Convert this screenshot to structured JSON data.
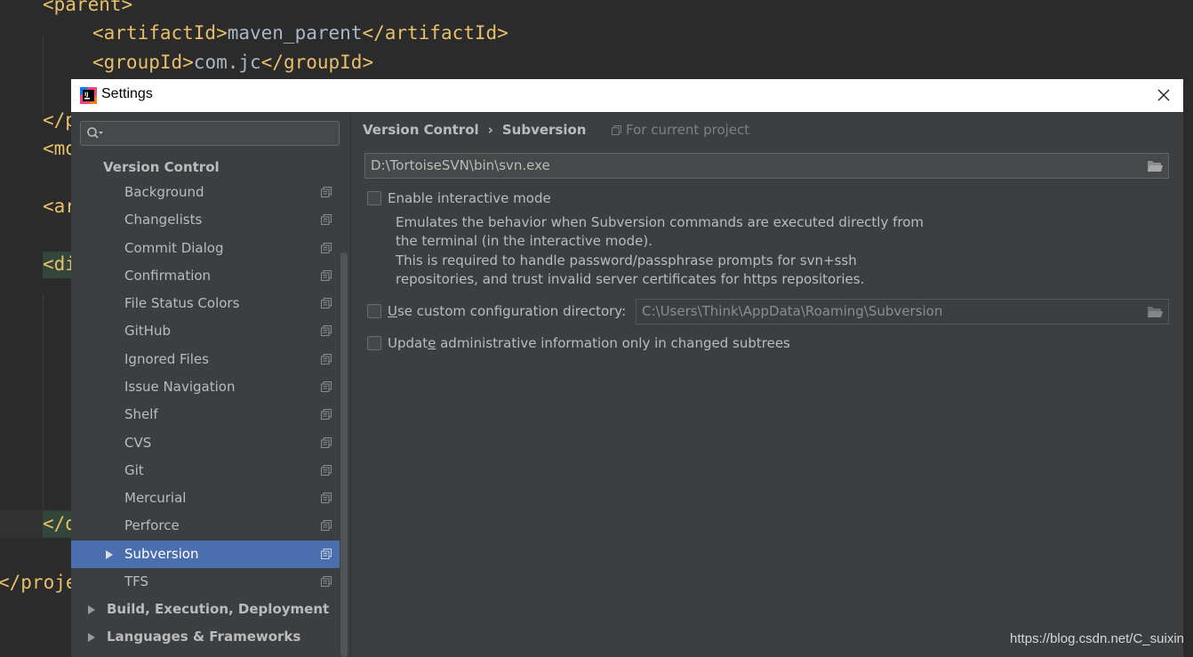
{
  "editor": {
    "lines": [
      {
        "open": "<parent>",
        "text": "",
        "close": ""
      },
      {
        "open": "<artifactId>",
        "text": "maven_parent",
        "close": "</artifactId>"
      },
      {
        "open": "<groupId>",
        "text": "com.jc",
        "close": "</groupId>"
      },
      {
        "open": "</p",
        "text": "",
        "close": ""
      },
      {
        "open": "<mo",
        "text": "",
        "close": ""
      },
      {
        "open": "<ar",
        "text": "",
        "close": ""
      },
      {
        "open": "<di",
        "text": "",
        "close": ""
      },
      {
        "open": "</d",
        "text": "",
        "close": ""
      },
      {
        "open": "</proje",
        "text": "",
        "close": ""
      }
    ]
  },
  "dialog": {
    "title": "Settings",
    "close_icon": "close-icon",
    "search": {
      "placeholder": ""
    },
    "tree": {
      "group_label": "Version Control",
      "items": [
        {
          "label": "Background"
        },
        {
          "label": "Changelists"
        },
        {
          "label": "Commit Dialog"
        },
        {
          "label": "Confirmation"
        },
        {
          "label": "File Status Colors"
        },
        {
          "label": "GitHub"
        },
        {
          "label": "Ignored Files"
        },
        {
          "label": "Issue Navigation"
        },
        {
          "label": "Shelf"
        },
        {
          "label": "CVS"
        },
        {
          "label": "Git"
        },
        {
          "label": "Mercurial"
        },
        {
          "label": "Perforce"
        },
        {
          "label": "Subversion",
          "selected": true
        },
        {
          "label": "TFS"
        }
      ],
      "sections": [
        {
          "label": "Build, Execution, Deployment"
        },
        {
          "label": "Languages & Frameworks"
        }
      ]
    },
    "breadcrumb": {
      "parent": "Version Control",
      "separator": "›",
      "current": "Subversion"
    },
    "scope_label": "For current project",
    "svn_path": "D:\\TortoiseSVN\\bin\\svn.exe",
    "interactive_mode": {
      "label": "Enable interactive mode",
      "checked": false,
      "description_lines": [
        "Emulates the behavior when Subversion commands are executed directly from",
        "the terminal (in the interactive mode).",
        "This is required to handle password/passphrase prompts for svn+ssh",
        "repositories, and trust invalid server certificates for https repositories."
      ]
    },
    "custom_config": {
      "label_mnemonic": "U",
      "label_rest": "se custom configuration directory:",
      "checked": false,
      "path": "C:\\Users\\Think\\AppData\\Roaming\\Subversion"
    },
    "update_admin": {
      "label_before": "Updat",
      "label_mnemonic": "e",
      "label_after": " administrative information only in changed subtrees",
      "checked": false
    }
  },
  "watermark": "https://blog.csdn.net/C_suixin",
  "colors": {
    "selection": "#4b6eaf",
    "panel": "#3c3f41",
    "tag": "#e8bf6a"
  }
}
